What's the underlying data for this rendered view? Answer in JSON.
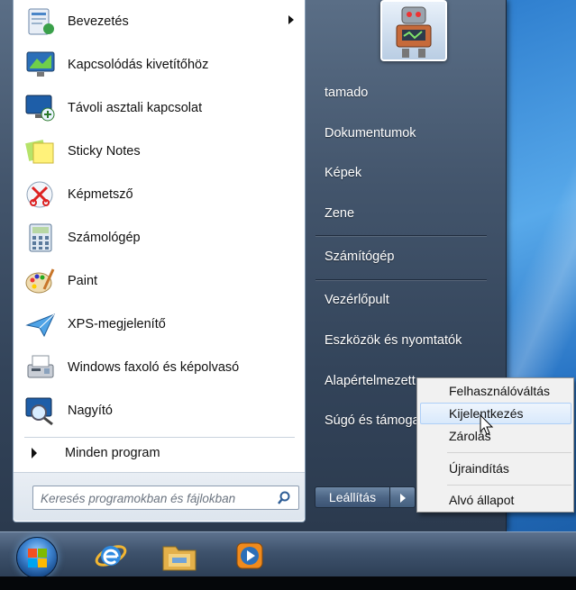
{
  "start_menu": {
    "programs": [
      {
        "label": "Bevezetés",
        "icon": "getting-started-icon",
        "has_submenu": true
      },
      {
        "label": "Kapcsolódás kivetítőhöz",
        "icon": "projector-icon"
      },
      {
        "label": "Távoli asztali kapcsolat",
        "icon": "remote-desktop-icon"
      },
      {
        "label": "Sticky Notes",
        "icon": "sticky-notes-icon"
      },
      {
        "label": "Képmetsző",
        "icon": "snipping-tool-icon"
      },
      {
        "label": "Számológép",
        "icon": "calculator-icon"
      },
      {
        "label": "Paint",
        "icon": "paint-icon"
      },
      {
        "label": "XPS-megjelenítő",
        "icon": "xps-viewer-icon"
      },
      {
        "label": "Windows faxoló és képolvasó",
        "icon": "fax-scanner-icon"
      },
      {
        "label": "Nagyító",
        "icon": "magnifier-icon"
      }
    ],
    "all_programs": "Minden program",
    "search_placeholder": "Keresés programokban és fájlokban",
    "right_links": [
      {
        "label": "tamado"
      },
      {
        "label": "Dokumentumok"
      },
      {
        "label": "Képek"
      },
      {
        "label": "Zene"
      },
      {
        "label": "Számítógép"
      },
      {
        "label": "Vezérlőpult"
      },
      {
        "label": "Eszközök és nyomtatók"
      },
      {
        "label": "Alapértelmezett"
      },
      {
        "label": "Súgó és támoga"
      }
    ],
    "shutdown_label": "Leállítás"
  },
  "context_menu": {
    "items": [
      {
        "label": "Felhasználóváltás"
      },
      {
        "label": "Kijelentkezés",
        "highlighted": true
      },
      {
        "label": "Zárolás"
      },
      {
        "label": "Újraindítás"
      },
      {
        "label": "Alvó állapot"
      }
    ]
  },
  "taskbar": {
    "items": [
      "start-orb",
      "internet-explorer-icon",
      "windows-explorer-icon",
      "media-player-icon"
    ]
  }
}
